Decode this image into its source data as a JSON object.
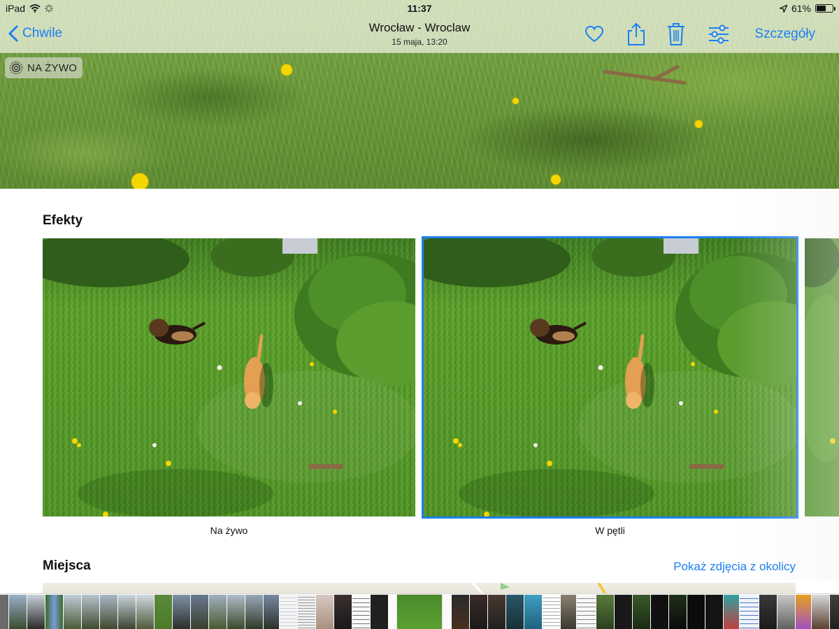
{
  "status_bar": {
    "device": "iPad",
    "time": "11:37",
    "battery_percent": "61%",
    "battery_level": 0.61
  },
  "nav": {
    "back_label": "Chwile",
    "title": "Wrocław - Wroclaw",
    "subtitle": "15 maja, 13:20",
    "details_label": "Szczegóły",
    "icons": [
      "heart-icon",
      "share-icon",
      "trash-icon",
      "adjust-icon"
    ]
  },
  "live_badge": {
    "label": "NA ŻYWO"
  },
  "effects": {
    "title": "Efekty",
    "items": [
      {
        "label": "Na żywo",
        "selected": false
      },
      {
        "label": "W pętli",
        "selected": true
      }
    ]
  },
  "places": {
    "title": "Miejsca",
    "link": "Pokaż zdjęcia z okolicy"
  },
  "colors": {
    "accent": "#1c7ff2",
    "navbar_bg": "#e8eeda",
    "grass": "#5f9a2e"
  }
}
